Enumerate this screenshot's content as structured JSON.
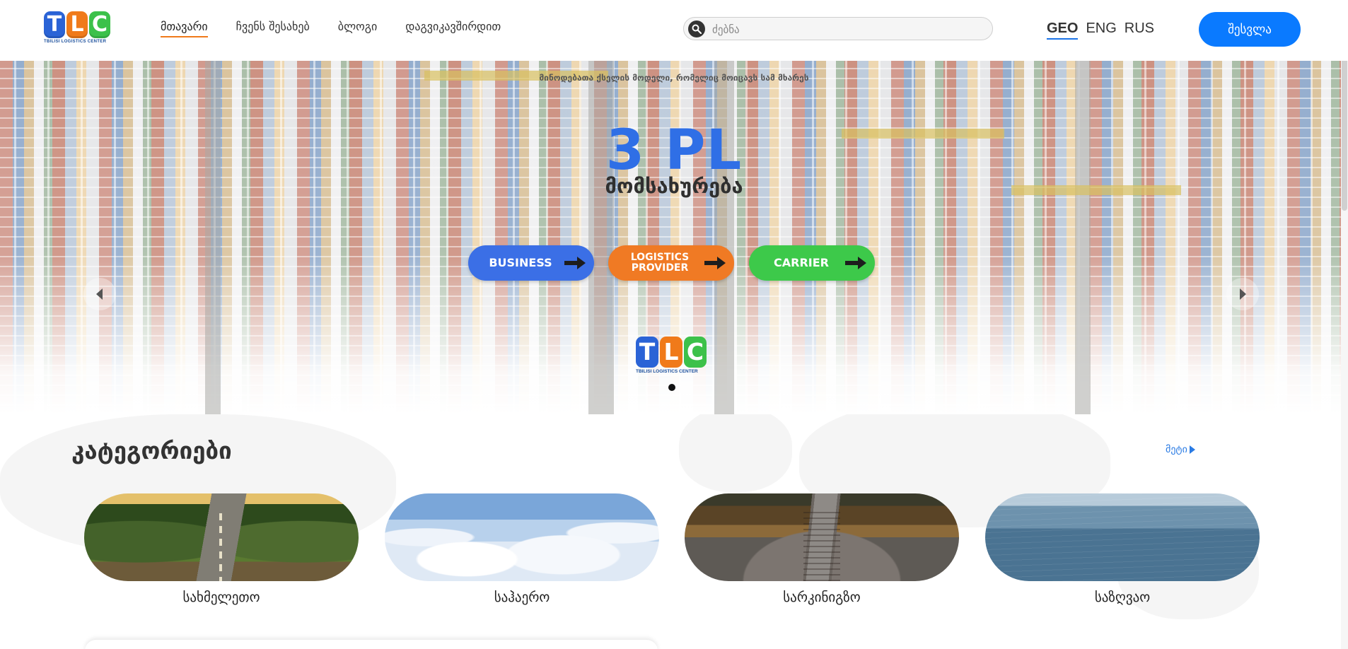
{
  "logo": {
    "letters": [
      "T",
      "L",
      "C"
    ],
    "letter_colors": [
      "#2a63d6",
      "#f07a1a",
      "#3cc14a"
    ],
    "subtitle": "TBILISI LOGISTICS CENTER"
  },
  "nav": {
    "items": [
      {
        "label": "მთავარი",
        "active": true
      },
      {
        "label": "ჩვენს შესახებ",
        "active": false
      },
      {
        "label": "ბლოგი",
        "active": false
      },
      {
        "label": "დაგვიკავშირდით",
        "active": false
      }
    ],
    "active_underline_color": "#f07a1a"
  },
  "search": {
    "placeholder": "ძებნა",
    "value": "",
    "icon": "search-icon"
  },
  "languages": {
    "items": [
      {
        "label": "GEO",
        "active": true
      },
      {
        "label": "ENG",
        "active": false
      },
      {
        "label": "RUS",
        "active": false
      }
    ]
  },
  "login_button": {
    "label": "შესვლა",
    "color": "#0a7aff"
  },
  "hero": {
    "eyebrow": "მინოდებათა ქსელის მოდელი, რომელიც მოიცავს სამ მხარეს",
    "headline": "3 PL",
    "subheadline": "მომსახურება",
    "buttons": [
      {
        "label": "BUSINESS",
        "color": "#3b6fe6",
        "icon": "arrow-right-icon"
      },
      {
        "label": "LOGISTICS PROVIDER",
        "color": "#f07a24",
        "icon": "arrow-right-icon"
      },
      {
        "label": "CARRIER",
        "color": "#3dc94a",
        "icon": "arrow-right-icon"
      }
    ],
    "logo_letters": [
      "T",
      "L",
      "C"
    ],
    "logo_subtitle": "TBILISI LOGISTICS CENTER",
    "prev_icon": "chevron-left-icon",
    "next_icon": "chevron-right-icon",
    "slides_count": 1,
    "active_slide": 1
  },
  "categories": {
    "title": "კატეგორიები",
    "more_label": "მეტი",
    "more_icon": "caret-right-icon",
    "items": [
      {
        "label": "სახმელეთო",
        "image": "road-photo"
      },
      {
        "label": "საჰაერო",
        "image": "clouds-photo"
      },
      {
        "label": "სარკინიგზო",
        "image": "railway-photo"
      },
      {
        "label": "საზღვაო",
        "image": "sea-photo"
      }
    ]
  }
}
